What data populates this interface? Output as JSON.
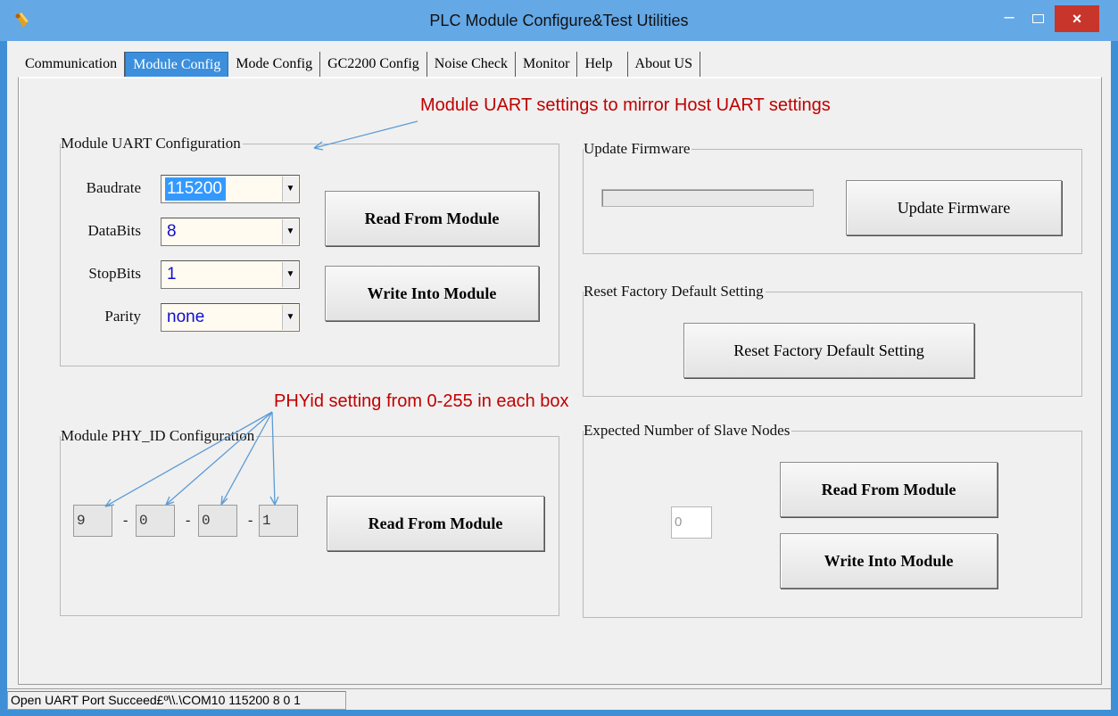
{
  "window": {
    "title": "PLC Module Configure&Test Utilities",
    "minimize_glyph": "–",
    "close_glyph": "×"
  },
  "tabs": [
    {
      "label": "Communication"
    },
    {
      "label": "Module Config"
    },
    {
      "label": "Mode Config"
    },
    {
      "label": "GC2200 Config"
    },
    {
      "label": "Noise Check"
    },
    {
      "label": "Monitor"
    },
    {
      "label": "Help"
    },
    {
      "label": "About US"
    }
  ],
  "active_tab": "Module Config",
  "uart_config": {
    "title": "Module UART  Configuration",
    "fields": [
      {
        "label": "Baudrate",
        "value": "115200"
      },
      {
        "label": "DataBits",
        "value": "8"
      },
      {
        "label": "StopBits",
        "value": "1"
      },
      {
        "label": "Parity",
        "value": "none"
      }
    ],
    "read_button": "Read From Module",
    "write_button": "Write Into Module"
  },
  "firmware": {
    "title": "Update Firmware",
    "button": "Update Firmware",
    "progress_percent": 0
  },
  "factory_reset": {
    "title": "Reset Factory Default Setting",
    "button": "Reset Factory Default Setting"
  },
  "phy_config": {
    "title": "Module PHY_ID Configuration",
    "values": [
      "9",
      "0",
      "0",
      "1"
    ],
    "separator": "-",
    "read_button": "Read From Module"
  },
  "slave_nodes": {
    "title": "Expected Number of Slave Nodes",
    "value": "0",
    "read_button": "Read From Module",
    "write_button": "Write Into Module"
  },
  "annotations": {
    "uart": "Module UART settings to mirror Host UART settings",
    "phy": "PHYid setting from 0-255 in each box"
  },
  "status": {
    "text": "Open UART Port Succeed£º\\\\.\\COM10 115200 8 0 1"
  },
  "colors": {
    "titlebar": "#64a8e6",
    "active_tab": "#3b8fdc",
    "close_button": "#c7352b",
    "annotation": "#c00000",
    "combo_value": "#1010d0",
    "arrow": "#5b9bd5"
  }
}
